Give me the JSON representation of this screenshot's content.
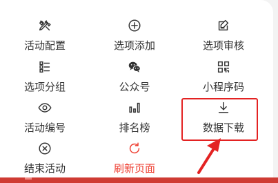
{
  "menu": {
    "items": [
      {
        "label": "活动配置",
        "icon": "tools-icon"
      },
      {
        "label": "选项添加",
        "icon": "plus-circle-icon"
      },
      {
        "label": "选项审核",
        "icon": "edit-square-icon"
      },
      {
        "label": "选项分组",
        "icon": "list-group-icon"
      },
      {
        "label": "公众号",
        "icon": "wechat-icon"
      },
      {
        "label": "小程序码",
        "icon": "qr-code-icon"
      },
      {
        "label": "活动编号",
        "icon": "eye-icon"
      },
      {
        "label": "排名榜",
        "icon": "bar-chart-icon"
      },
      {
        "label": "数据下载",
        "icon": "download-icon"
      },
      {
        "label": "结束活动",
        "icon": "close-circle-icon"
      },
      {
        "label": "刷新页面",
        "icon": "refresh-icon"
      }
    ]
  },
  "colors": {
    "text": "#333333",
    "icon": "#333333",
    "danger": "#ee3a2c",
    "annotation": "#e32222",
    "bottom_bar": "#cf3b33"
  },
  "annotation": {
    "highlighted_item": "数据下载"
  }
}
